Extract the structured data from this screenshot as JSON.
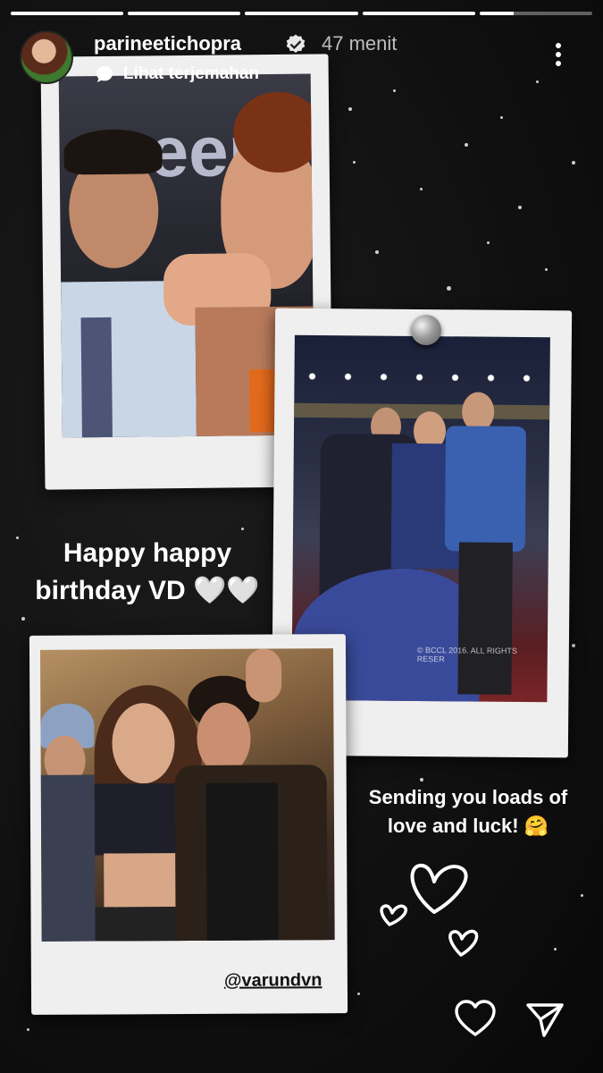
{
  "progress": [
    1,
    1,
    1,
    1,
    0.3
  ],
  "header": {
    "username": "parineetichopra",
    "time": "47 menit",
    "translate_label": "Lihat terjemahan"
  },
  "story": {
    "caption_birthday": "Happy happy birthday VD 🤍🤍",
    "caption_love": "Sending you loads of love and luck! 🤗",
    "mention": "@varundvn",
    "watermark": "© BCCL 2016. ALL RIGHTS RESER"
  },
  "colors": {
    "background": "#0d0d0d",
    "polaroid": "#efefef",
    "accent_text": "#ffffff"
  },
  "icons": {
    "verified": "verified-badge-icon",
    "translate": "speech-bubble-icon",
    "more": "more-vertical-icon",
    "like": "heart-outline-icon",
    "share": "send-arrow-icon"
  }
}
